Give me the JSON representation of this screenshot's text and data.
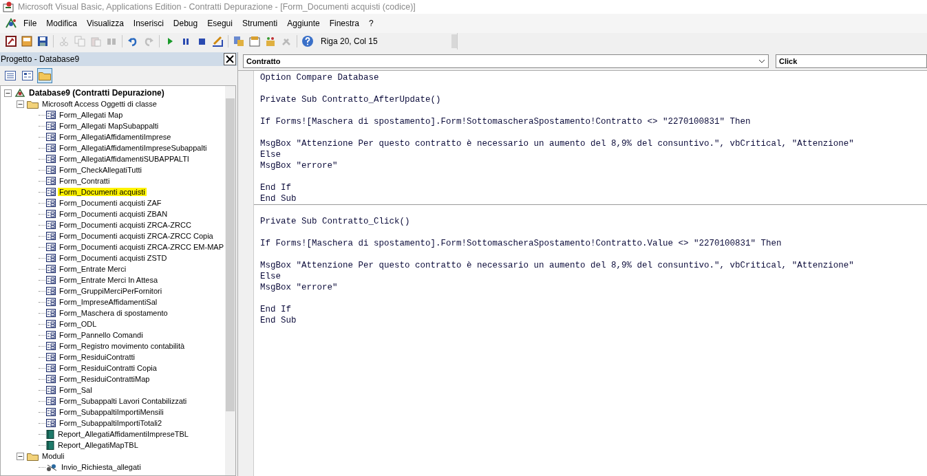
{
  "window": {
    "title": "Microsoft Visual Basic, Applications Edition - Contratti Depurazione - [Form_Documenti acquisti (codice)]"
  },
  "menu": [
    {
      "label": "File"
    },
    {
      "label": "Modifica"
    },
    {
      "label": "Visualizza"
    },
    {
      "label": "Inserisci"
    },
    {
      "label": "Debug"
    },
    {
      "label": "Esegui"
    },
    {
      "label": "Strumenti"
    },
    {
      "label": "Aggiunte"
    },
    {
      "label": "Finestra"
    },
    {
      "label": "?"
    }
  ],
  "toolbar": {
    "buttons": [
      {
        "kind": "access",
        "disabled": false
      },
      {
        "kind": "insert",
        "disabled": false
      },
      {
        "kind": "save",
        "disabled": false
      },
      {
        "kind": "sep"
      },
      {
        "kind": "cut",
        "disabled": true
      },
      {
        "kind": "copy",
        "disabled": true
      },
      {
        "kind": "paste",
        "disabled": true
      },
      {
        "kind": "find",
        "disabled": true
      },
      {
        "kind": "sep"
      },
      {
        "kind": "undo",
        "disabled": false
      },
      {
        "kind": "redo",
        "disabled": true
      },
      {
        "kind": "sep"
      },
      {
        "kind": "run",
        "disabled": false
      },
      {
        "kind": "pause",
        "disabled": false
      },
      {
        "kind": "stop",
        "disabled": false
      },
      {
        "kind": "design",
        "disabled": false
      },
      {
        "kind": "sep"
      },
      {
        "kind": "explorer",
        "disabled": false
      },
      {
        "kind": "properties",
        "disabled": false
      },
      {
        "kind": "browser",
        "disabled": false
      },
      {
        "kind": "tools",
        "disabled": true
      },
      {
        "kind": "sep"
      },
      {
        "kind": "help",
        "disabled": false
      }
    ],
    "position": "Riga 20, Col 15"
  },
  "project": {
    "title": "Progetto - Database9",
    "view_buttons": [
      {
        "kind": "code",
        "selected": false
      },
      {
        "kind": "object",
        "selected": false
      },
      {
        "kind": "folders",
        "selected": true
      }
    ],
    "tree": [
      {
        "label": "Database9 (Contratti Depurazione)",
        "kind": "project",
        "expanded": true,
        "selected": false,
        "children": [
          {
            "label": "Microsoft Access Oggetti di classe",
            "kind": "folder",
            "expanded": true,
            "selected": false,
            "children": [
              {
                "label": "Form_Allegati Map",
                "kind": "form",
                "selected": false
              },
              {
                "label": "Form_Allegati MapSubappalti",
                "kind": "form",
                "selected": false
              },
              {
                "label": "Form_AllegatiAffidamentiImprese",
                "kind": "form",
                "selected": false
              },
              {
                "label": "Form_AllegatiAffidamentiImpreseSubappalti",
                "kind": "form",
                "selected": false
              },
              {
                "label": "Form_AllegatiAffidamentiSUBAPPALTI",
                "kind": "form",
                "selected": false
              },
              {
                "label": "Form_CheckAllegatiTutti",
                "kind": "form",
                "selected": false
              },
              {
                "label": "Form_Contratti",
                "kind": "form",
                "selected": false
              },
              {
                "label": "Form_Documenti acquisti",
                "kind": "form",
                "selected": true
              },
              {
                "label": "Form_Documenti acquisti ZAF",
                "kind": "form",
                "selected": false
              },
              {
                "label": "Form_Documenti acquisti ZBAN",
                "kind": "form",
                "selected": false
              },
              {
                "label": "Form_Documenti acquisti ZRCA-ZRCC",
                "kind": "form",
                "selected": false
              },
              {
                "label": "Form_Documenti acquisti ZRCA-ZRCC Copia",
                "kind": "form",
                "selected": false
              },
              {
                "label": "Form_Documenti acquisti ZRCA-ZRCC EM-MAP",
                "kind": "form",
                "selected": false
              },
              {
                "label": "Form_Documenti acquisti ZSTD",
                "kind": "form",
                "selected": false
              },
              {
                "label": "Form_Entrate Merci",
                "kind": "form",
                "selected": false
              },
              {
                "label": "Form_Entrate Merci In Attesa",
                "kind": "form",
                "selected": false
              },
              {
                "label": "Form_GruppiMerciPerFornitori",
                "kind": "form",
                "selected": false
              },
              {
                "label": "Form_ImpreseAffidamentiSal",
                "kind": "form",
                "selected": false
              },
              {
                "label": "Form_Maschera di spostamento",
                "kind": "form",
                "selected": false
              },
              {
                "label": "Form_ODL",
                "kind": "form",
                "selected": false
              },
              {
                "label": "Form_Pannello Comandi",
                "kind": "form",
                "selected": false
              },
              {
                "label": "Form_Registro movimento contabilità",
                "kind": "form",
                "selected": false
              },
              {
                "label": "Form_ResiduiContratti",
                "kind": "form",
                "selected": false
              },
              {
                "label": "Form_ResiduiContratti Copia",
                "kind": "form",
                "selected": false
              },
              {
                "label": "Form_ResiduiContrattiMap",
                "kind": "form",
                "selected": false
              },
              {
                "label": "Form_Sal",
                "kind": "form",
                "selected": false
              },
              {
                "label": "Form_Subappalti Lavori Contabilizzati",
                "kind": "form",
                "selected": false
              },
              {
                "label": "Form_SubappaltiImportiMensili",
                "kind": "form",
                "selected": false
              },
              {
                "label": "Form_SubappaltiImportiTotali2",
                "kind": "form",
                "selected": false
              },
              {
                "label": "Report_AllegatiAffidamentiImpreseTBL",
                "kind": "report",
                "selected": false
              },
              {
                "label": "Report_AllegatiMapTBL",
                "kind": "report",
                "selected": false
              }
            ]
          },
          {
            "label": "Moduli",
            "kind": "folder",
            "expanded": true,
            "selected": false,
            "children": [
              {
                "label": "Invio_Richiesta_allegati",
                "kind": "module",
                "selected": false
              }
            ]
          }
        ]
      }
    ]
  },
  "code": {
    "object": "Contratto",
    "procedure": "Click",
    "sections": [
      {
        "groups": [
          [
            "Option Compare Database"
          ],
          [
            "Private Sub Contratto_AfterUpdate()"
          ],
          [
            "If Forms![Maschera di spostamento].Form!SottomascheraSpostamento!Contratto <> \"2270100831\" Then"
          ],
          [
            "MsgBox \"Attenzione Per questo contratto è necessario un aumento del 8,9% del consuntivo.\", vbCritical, \"Attenzione\"",
            "Else",
            "MsgBox \"errore\""
          ],
          [
            "End If",
            "End Sub"
          ]
        ]
      },
      {
        "groups": [
          [
            "Private Sub Contratto_Click()"
          ],
          [
            "If Forms![Maschera di spostamento].Form!SottomascheraSpostamento!Contratto.Value <> \"2270100831\" Then"
          ],
          [
            "MsgBox \"Attenzione Per questo contratto è necessario un aumento del 8,9% del consuntivo.\", vbCritical, \"Attenzione\"",
            "Else",
            "MsgBox \"errore\""
          ],
          [
            "End If",
            "End Sub"
          ]
        ]
      }
    ]
  }
}
